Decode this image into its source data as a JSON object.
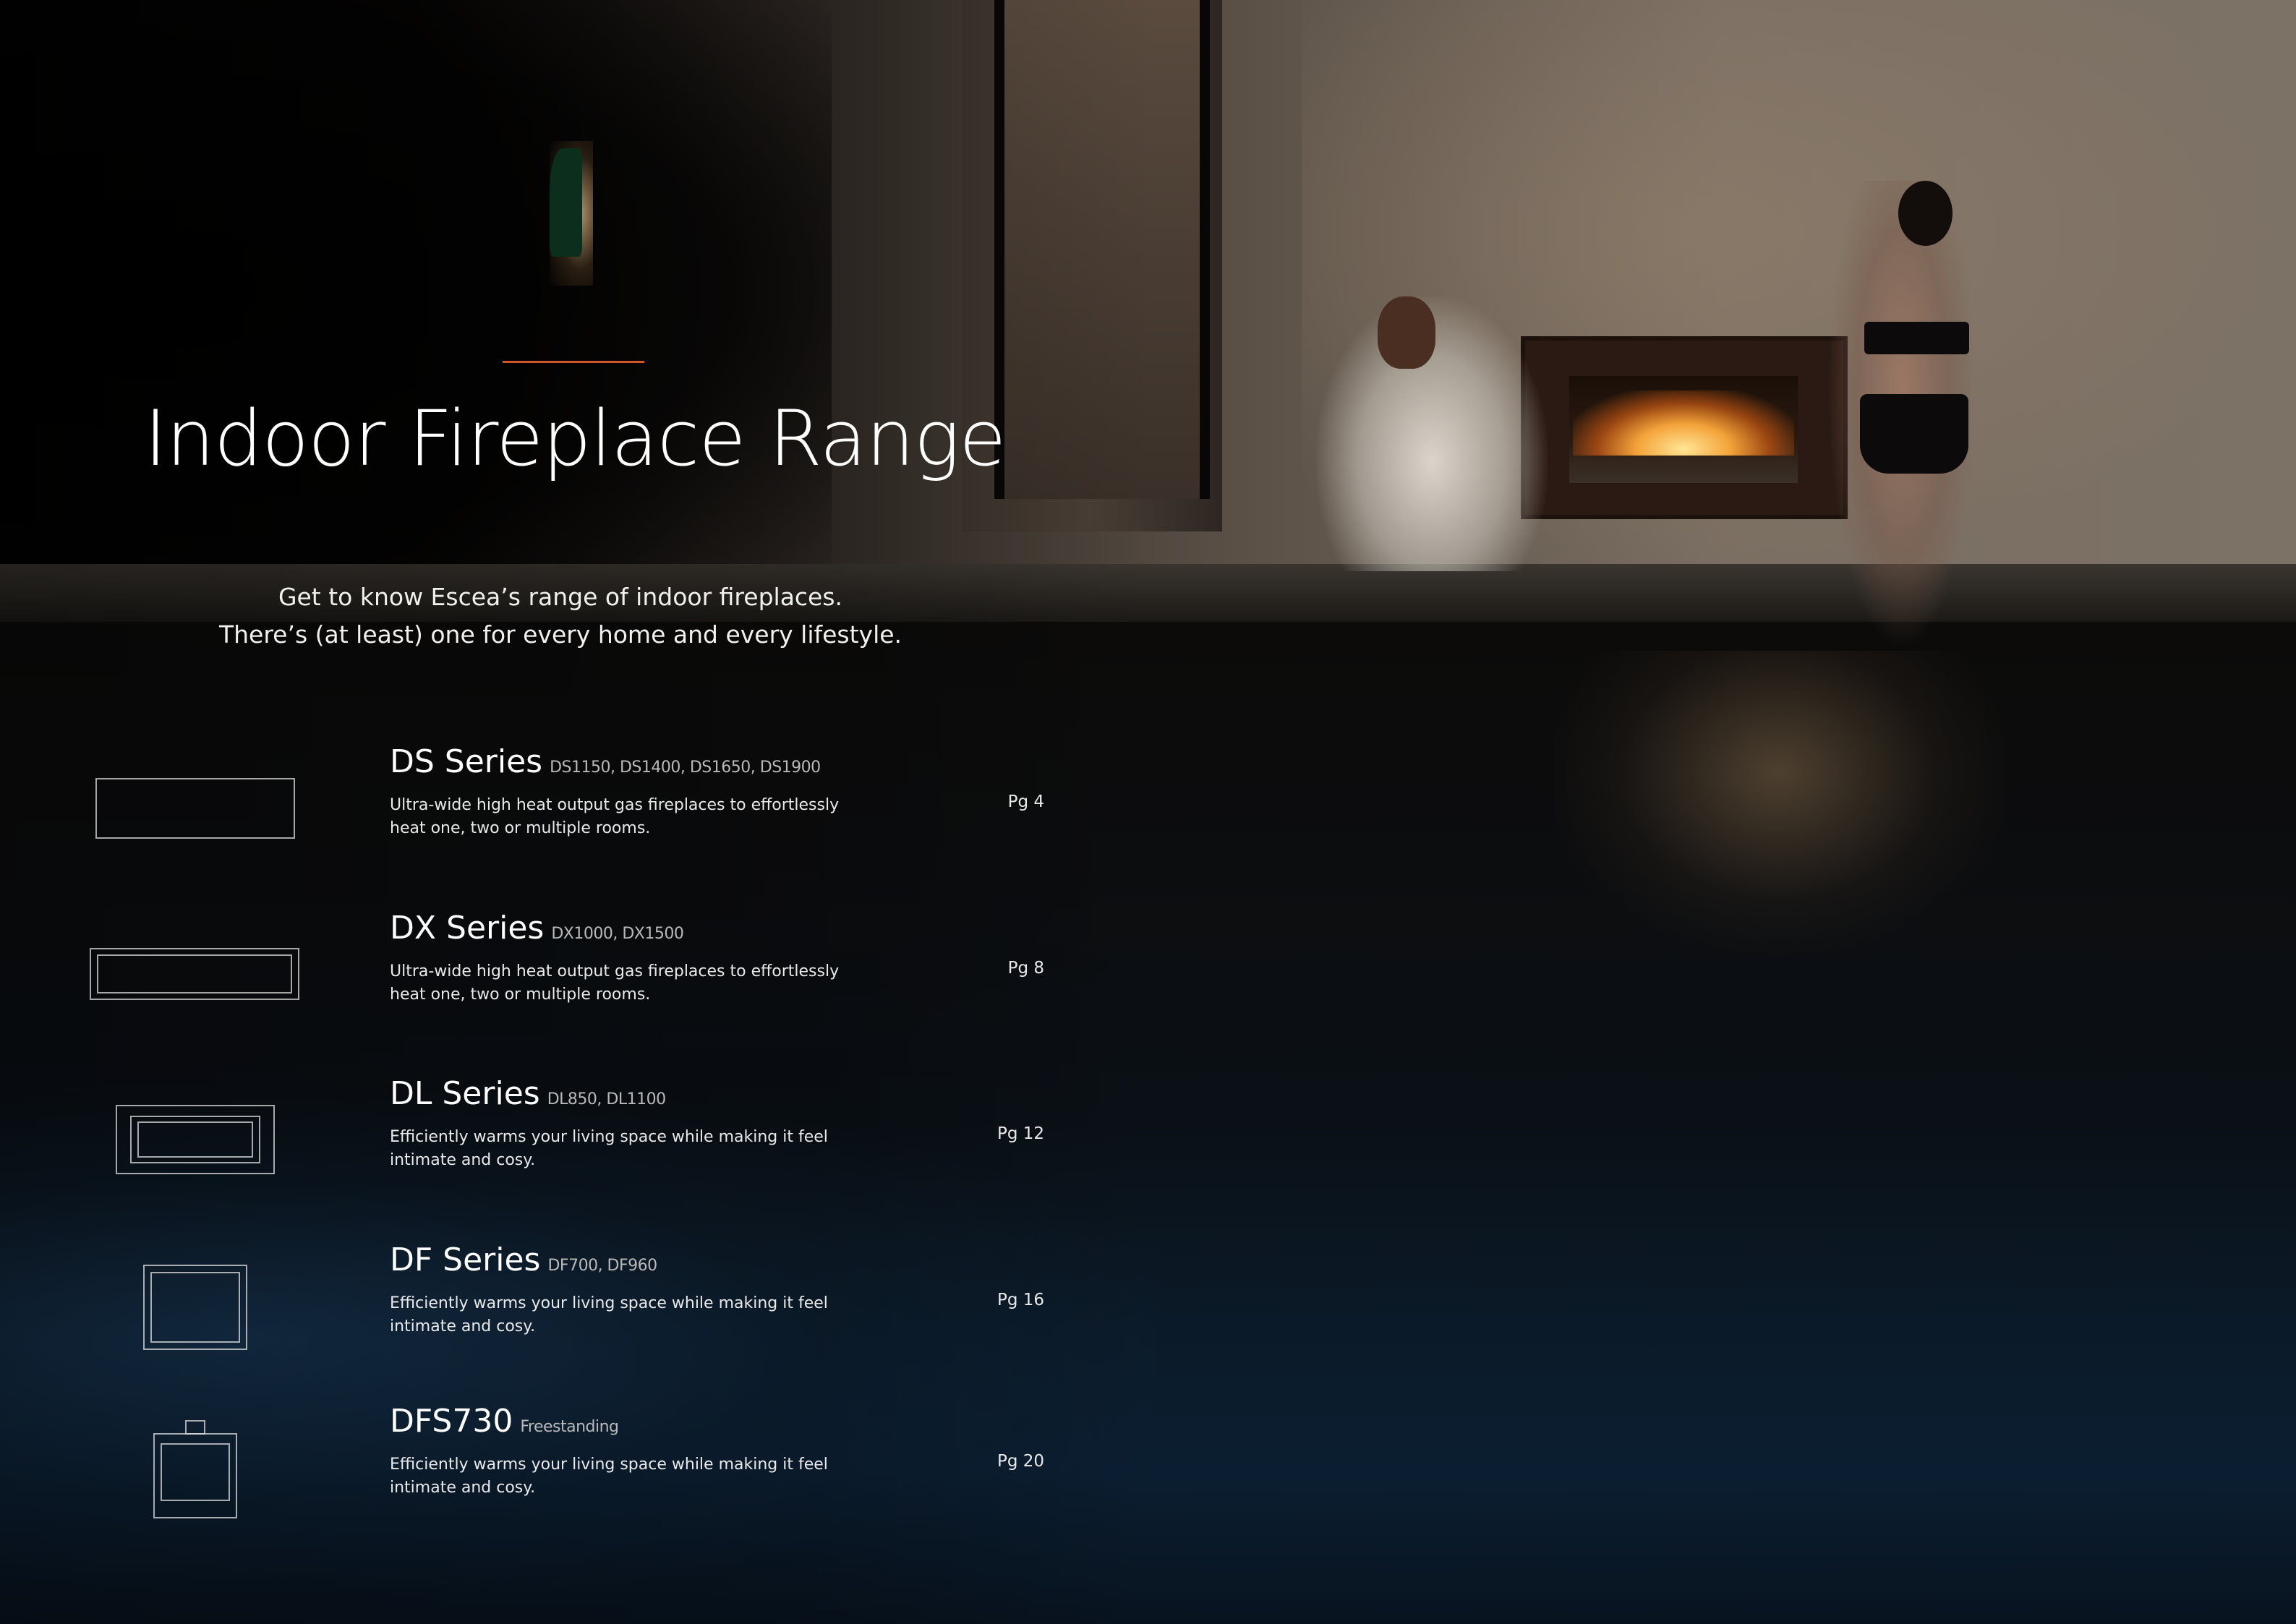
{
  "page": {
    "title": "Indoor Fireplace Range",
    "intro_lines": [
      "Get to know Escea’s range of indoor fireplaces.",
      "There’s (at least) one for every home and every lifestyle."
    ],
    "accent_color": "#d2552a"
  },
  "series": [
    {
      "name": "DS Series",
      "models": "DS1150, DS1400, DS1650, DS1900",
      "description_lines": [
        "Ultra-wide high heat output gas fireplaces to effortlessly",
        "heat one, two or multiple rooms."
      ],
      "page": "Pg 4",
      "icon": "ultra-wide-fireplace-icon"
    },
    {
      "name": "DX Series",
      "models": "DX1000, DX1500",
      "description_lines": [
        "Ultra-wide high heat output gas fireplaces to effortlessly",
        "heat one, two or multiple rooms."
      ],
      "page": "Pg 8",
      "icon": "wide-fireplace-icon"
    },
    {
      "name": "DL Series",
      "models": "DL850, DL1100",
      "description_lines": [
        "Efficiently warms your living space while making it feel",
        "intimate and cosy."
      ],
      "page": "Pg 12",
      "icon": "framed-fireplace-icon"
    },
    {
      "name": "DF Series",
      "models": "DF700, DF960",
      "description_lines": [
        "Efficiently warms your living space while making it feel",
        "intimate and cosy."
      ],
      "page": "Pg 16",
      "icon": "square-fireplace-icon"
    },
    {
      "name": "DFS730",
      "models": "Freestanding",
      "description_lines": [
        "Efficiently warms your living space while making it feel",
        "intimate and cosy."
      ],
      "page": "Pg 20",
      "icon": "freestanding-fireplace-icon"
    }
  ]
}
